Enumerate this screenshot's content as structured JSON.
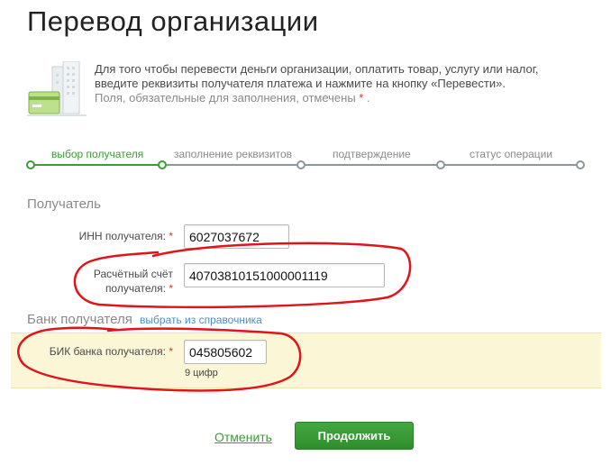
{
  "page": {
    "title": "Перевод организации"
  },
  "intro": {
    "line1": "Для того чтобы перевести деньги организации, оплатить товар, услугу или налог,",
    "line2": "введите реквизиты получателя платежа и нажмите на кнопку «Перевести».",
    "required_note": "Поля, обязательные для заполнения, отмечены",
    "required_star": "*",
    "required_end": "."
  },
  "steps": [
    {
      "label": "выбор получателя",
      "state": "active"
    },
    {
      "label": "заполнение реквизитов",
      "state": "inactive"
    },
    {
      "label": "подтверждение",
      "state": "inactive"
    },
    {
      "label": "статус операции",
      "state": "inactive"
    }
  ],
  "recipient": {
    "section_title": "Получатель",
    "inn_label": "ИНН получателя:",
    "inn_value": "6027037672",
    "account_label_1": "Расчётный счёт",
    "account_label_2": "получателя:",
    "account_value": "40703810151000001119",
    "star": "*"
  },
  "bank": {
    "section_title": "Банк получателя",
    "directory_link": "выбрать из справочника",
    "bik_label": "БИК банка получателя:",
    "bik_value": "045805602",
    "bik_hint": "9 цифр",
    "star": "*"
  },
  "actions": {
    "cancel_label": "Отменить",
    "continue_label": "Продолжить"
  },
  "colors": {
    "accent_green": "#3f9a3a",
    "button_green": "#2f8d2d",
    "required_red": "#d9342b",
    "highlight_band": "#fbf6d6",
    "annotation_red": "#e0141a"
  }
}
